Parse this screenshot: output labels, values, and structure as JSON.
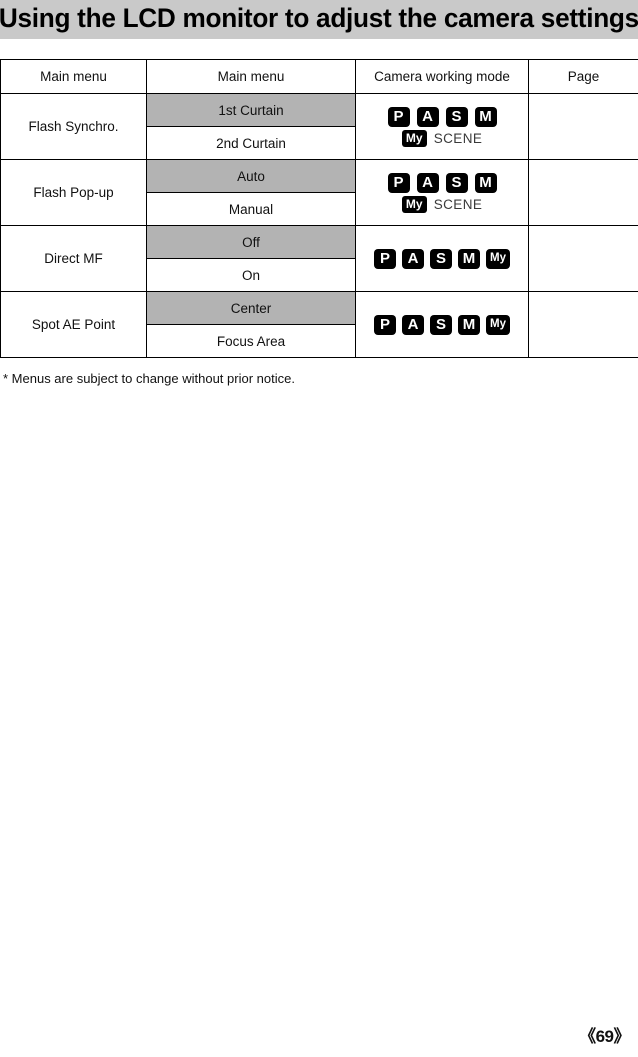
{
  "header": {
    "title": "Using the LCD monitor to adjust the camera settings"
  },
  "table": {
    "columns": [
      {
        "id": "main-menu-1",
        "label": "Main menu"
      },
      {
        "id": "main-menu-2",
        "label": "Main menu"
      },
      {
        "id": "camera-working-mode",
        "label": "Camera working mode"
      },
      {
        "id": "page",
        "label": "Page"
      }
    ],
    "rows": [
      {
        "main_menu": "Flash Synchro.",
        "options": [
          {
            "label": "1st Curtain",
            "highlighted": true
          },
          {
            "label": "2nd Curtain",
            "highlighted": false
          }
        ],
        "modes": {
          "layout": "two-line",
          "line1": [
            "P",
            "A",
            "S",
            "M"
          ],
          "line2_badge": "My",
          "line2_text": "SCENE"
        },
        "page": ""
      },
      {
        "main_menu": "Flash Pop-up",
        "options": [
          {
            "label": "Auto",
            "highlighted": true
          },
          {
            "label": "Manual",
            "highlighted": false
          }
        ],
        "modes": {
          "layout": "two-line",
          "line1": [
            "P",
            "A",
            "S",
            "M"
          ],
          "line2_badge": "My",
          "line2_text": "SCENE"
        },
        "page": ""
      },
      {
        "main_menu": "Direct MF",
        "options": [
          {
            "label": "Off",
            "highlighted": true
          },
          {
            "label": "On",
            "highlighted": false
          }
        ],
        "modes": {
          "layout": "one-line",
          "line1": [
            "P",
            "A",
            "S",
            "M"
          ],
          "inline_badge": "My"
        },
        "page": ""
      },
      {
        "main_menu": "Spot AE Point",
        "options": [
          {
            "label": "Center",
            "highlighted": true
          },
          {
            "label": "Focus Area",
            "highlighted": false
          }
        ],
        "modes": {
          "layout": "one-line",
          "line1": [
            "P",
            "A",
            "S",
            "M"
          ],
          "inline_badge": "My"
        },
        "page": ""
      }
    ]
  },
  "footnote": "* Menus are subject to change without prior notice.",
  "page_number": "《69》",
  "colors": {
    "title_band": "#c9c9c9",
    "highlight_row": "#b3b3b3",
    "badge_bg": "#000000",
    "badge_fg": "#ffffff",
    "border": "#000000"
  }
}
